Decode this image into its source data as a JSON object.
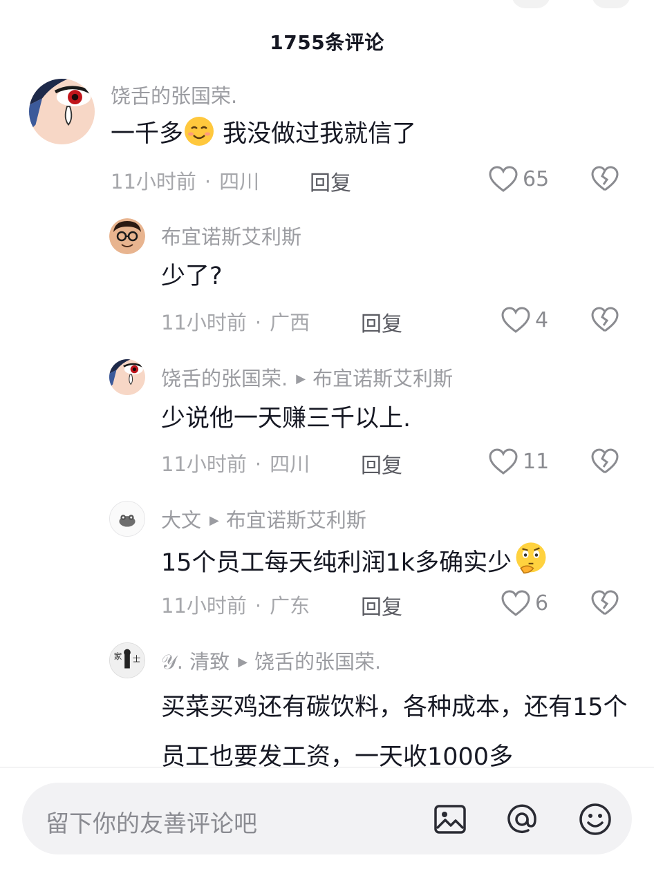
{
  "header": {
    "title": "1755条评论"
  },
  "comments": [
    {
      "user": "饶舌的张国荣.",
      "text_before": "一千多",
      "emoji": "smiling-face-emoji",
      "text_after": " 我没做过我就信了",
      "time": "11小时前",
      "location": "四川",
      "reply_label": "回复",
      "likes": "65"
    },
    {
      "user": "布宜诺斯艾利斯",
      "text": "少了?",
      "time": "11小时前",
      "location": "广西",
      "reply_label": "回复",
      "likes": "4"
    },
    {
      "user": "饶舌的张国荣.",
      "reply_to": "布宜诺斯艾利斯",
      "text": "少说他一天赚三千以上.",
      "time": "11小时前",
      "location": "四川",
      "reply_label": "回复",
      "likes": "11"
    },
    {
      "user": "大文",
      "reply_to": "布宜诺斯艾利斯",
      "text": "15个员工每天纯利润1k多确实少",
      "emoji": "thinking-face-emoji",
      "time": "11小时前",
      "location": "广东",
      "reply_label": "回复",
      "likes": "6"
    },
    {
      "user": "𝒴. 清致",
      "reply_to": "饶舌的张国荣.",
      "text": "买菜买鸡还有碳饮料，各种成本，还有15个员工也要发工资，一天收1000多"
    }
  ],
  "input": {
    "placeholder": "留下你的友善评论吧"
  },
  "toolbar": {
    "icons": [
      "image-icon",
      "at-icon",
      "emoji-icon"
    ]
  },
  "colors": {
    "secondary_text": "#9b9ca1",
    "primary_text": "#161823",
    "input_bg": "#f2f2f4"
  }
}
